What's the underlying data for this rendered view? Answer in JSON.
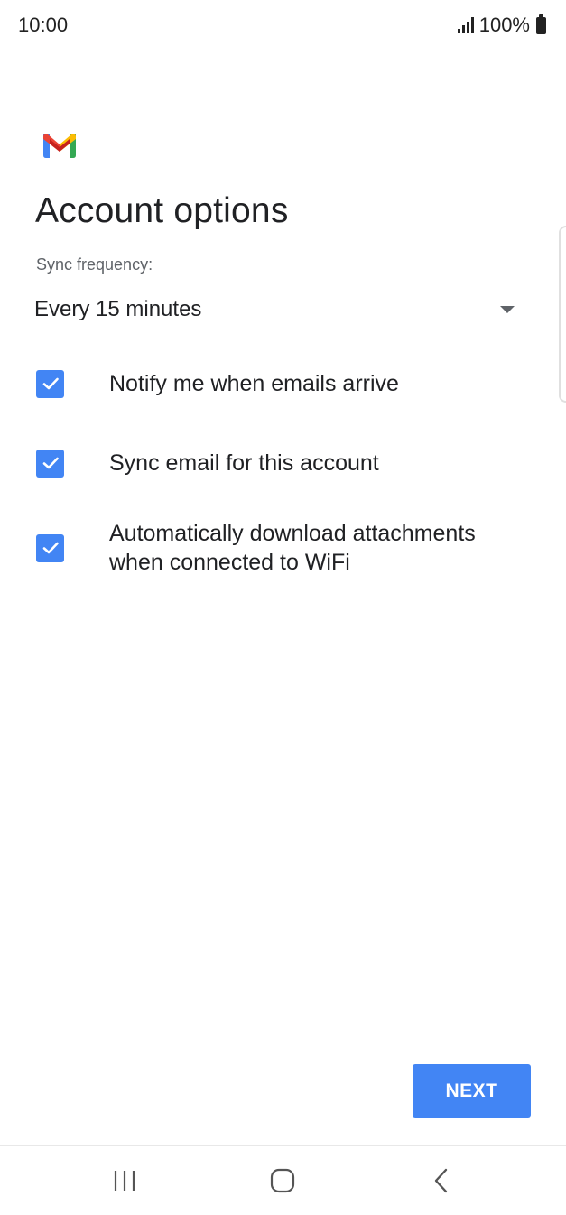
{
  "status_bar": {
    "time": "10:00",
    "battery": "100%"
  },
  "page": {
    "title": "Account options",
    "sync_label": "Sync frequency:",
    "sync_value": "Every 15 minutes"
  },
  "options": [
    {
      "label": "Notify me when emails arrive",
      "checked": true
    },
    {
      "label": "Sync email for this account",
      "checked": true
    },
    {
      "label": "Automatically download attachments when connected to WiFi",
      "checked": true
    }
  ],
  "actions": {
    "next_label": "NEXT"
  },
  "colors": {
    "accent": "#4285f4",
    "text_primary": "#202124",
    "text_secondary": "#5f6368"
  },
  "icons": {
    "logo": "gmail-logo-icon",
    "nav_recents": "recents-icon",
    "nav_home": "home-icon",
    "nav_back": "back-icon"
  }
}
